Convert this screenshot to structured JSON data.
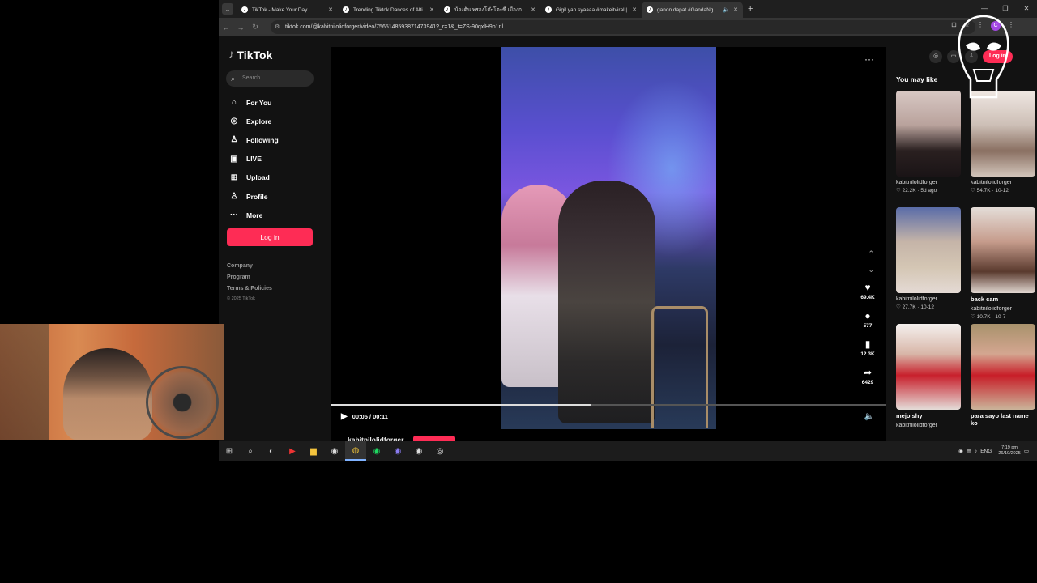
{
  "browser": {
    "tabs": [
      {
        "title": "TikTok - Make Your Day",
        "active": false
      },
      {
        "title": "Trending Tiktok Dances of Alti",
        "active": false
      },
      {
        "title": "น้องต้น พรองโต๊ะโตะซี เมืองกองสวนคนเมา",
        "active": false
      },
      {
        "title": "Gigil yan syaaaa #makeitviral |",
        "active": false
      },
      {
        "title": "ganon dapat #GandaNgGa",
        "active": true
      }
    ],
    "new_tab": "+",
    "url": "tiktok.com/@kabitnilolidforger/video/7565148593871473941?_r=1&_t=ZS-90qxlH9o1nl",
    "profile_initial": "C"
  },
  "tiktok": {
    "logo": "TikTok",
    "search_placeholder": "Search",
    "nav": [
      {
        "label": "For You",
        "icon": "home-icon",
        "glyph": "⌂"
      },
      {
        "label": "Explore",
        "icon": "compass-icon",
        "glyph": "◎"
      },
      {
        "label": "Following",
        "icon": "following-icon",
        "glyph": "♙"
      },
      {
        "label": "LIVE",
        "icon": "live-icon",
        "glyph": "▣"
      },
      {
        "label": "Upload",
        "icon": "upload-icon",
        "glyph": "⊞"
      },
      {
        "label": "Profile",
        "icon": "profile-icon",
        "glyph": "♙"
      },
      {
        "label": "More",
        "icon": "more-icon",
        "glyph": "···"
      }
    ],
    "login_label": "Log in",
    "footer": [
      "Company",
      "Program",
      "Terms & Policies"
    ],
    "copyright": "© 2025 TikTok",
    "top_login": "Log in"
  },
  "video": {
    "likes": "69.4K",
    "comments": "577",
    "saves": "12.3K",
    "shares": "6429",
    "time": "00:05 / 00:11",
    "progress_fraction": 0.47,
    "author": "kabitnilolidforger"
  },
  "recommendations": {
    "title": "You may like",
    "items": [
      {
        "title": "",
        "user": "kabitnilolidforger",
        "stats": "♡ 22.2K · 5d ago"
      },
      {
        "title": "",
        "user": "kabitnilolidforger",
        "stats": "♡ 54.7K · 10-12"
      },
      {
        "title": "",
        "user": "kabitnilolidforger",
        "stats": "♡ 27.7K · 10-12"
      },
      {
        "title": "back cam",
        "user": "kabitnilolidforger",
        "stats": "♡ 10.7K · 10-7"
      },
      {
        "title": "mejo shy",
        "user": "kabitnilolidforger",
        "stats": ""
      },
      {
        "title": "para sayo last name ko",
        "user": "",
        "stats": ""
      }
    ]
  },
  "taskbar": {
    "language": "ENG",
    "time": "7:19 pm",
    "date": "26/10/2025"
  },
  "colors": {
    "accent": "#fe2c55",
    "page_bg": "#121212"
  }
}
